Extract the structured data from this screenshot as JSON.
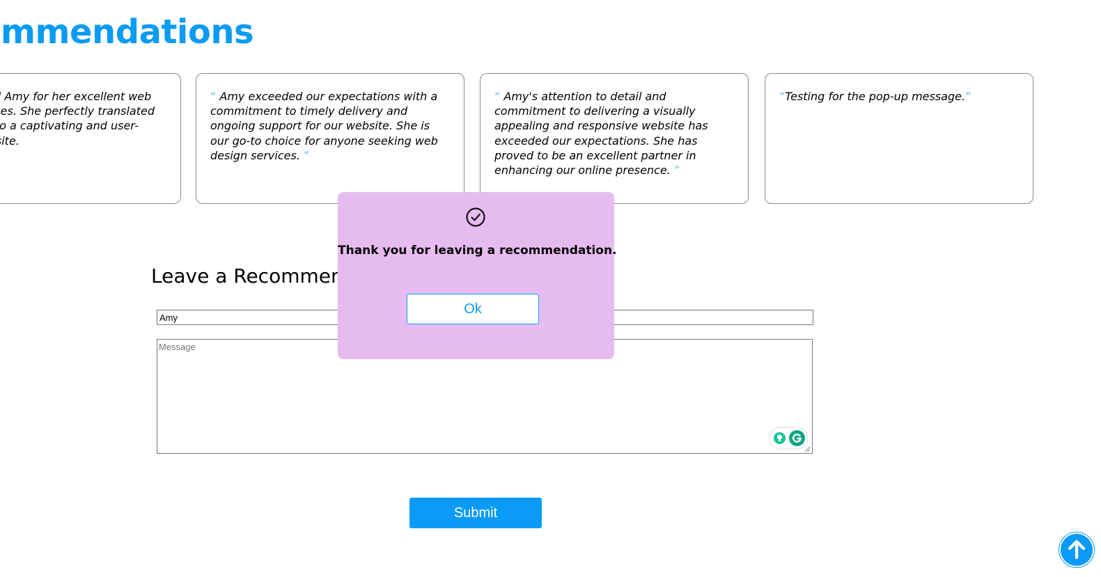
{
  "section": {
    "title": "Recommendations"
  },
  "recommendations": [
    {
      "open_quote": "“",
      "text": "I recommend Amy for her excellent web design services. She perfectly translated our vision into a captivating and user-friendly website.",
      "close_quote": "”"
    },
    {
      "open_quote": "“",
      "text": " Amy exceeded our expectations with a commitment to timely delivery and ongoing support for our website. She is our go-to choice for anyone seeking web design services. ",
      "close_quote": "”"
    },
    {
      "open_quote": "“",
      "text": " Amy's attention to detail and commitment to delivering a visually appealing and responsive website has exceeded our expectations. She has proved to be an excellent partner in enhancing our online presence. ",
      "close_quote": "”"
    },
    {
      "open_quote": "“",
      "text": "Testing for the pop-up message.",
      "close_quote": "”"
    }
  ],
  "form": {
    "title": "Leave a Recommendation",
    "name_value": "Amy",
    "message_placeholder": "Message",
    "submit_label": "Submit"
  },
  "dialog": {
    "message": "Thank you for leaving a recommendation.",
    "ok_label": "Ok"
  },
  "colors": {
    "accent": "#0b9bf2",
    "dialog_background": "#e6bcf0",
    "quote_marks": "#5ab8f0"
  },
  "icons": {
    "dialog": "check-circle-icon",
    "scroll_top": "arrow-up-icon",
    "grammarly": [
      "grammarly-bulb-icon",
      "grammarly-logo-icon"
    ]
  }
}
